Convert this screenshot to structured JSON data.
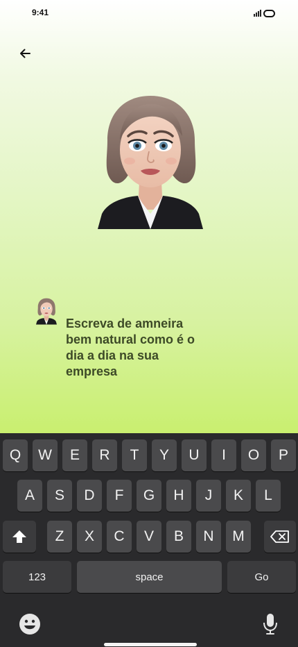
{
  "status": {
    "time": "9:41"
  },
  "chat": {
    "message": "Escreva de amneira bem natural como é o dia a dia na sua empresa"
  },
  "keyboard": {
    "row1": [
      "Q",
      "W",
      "E",
      "R",
      "T",
      "Y",
      "U",
      "I",
      "O",
      "P"
    ],
    "row2": [
      "A",
      "S",
      "D",
      "F",
      "G",
      "H",
      "J",
      "K",
      "L"
    ],
    "row3": [
      "Z",
      "X",
      "C",
      "V",
      "B",
      "N",
      "M"
    ],
    "numbers_label": "123",
    "space_label": "space",
    "go_label": "Go"
  },
  "icons": {
    "back": "arrow-left-icon",
    "shift": "shift-arrow-icon",
    "delete": "backspace-icon",
    "emoji": "emoji-icon",
    "mic": "microphone-icon"
  },
  "colors": {
    "message_text": "#3d4a27",
    "keyboard_bg": "#2a2a2c",
    "key_bg": "#4a4a4c"
  }
}
